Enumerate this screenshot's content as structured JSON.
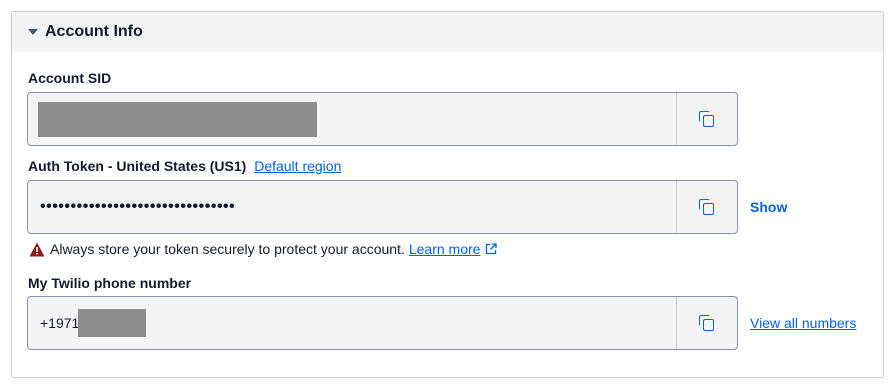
{
  "panel": {
    "title": "Account Info"
  },
  "account_sid": {
    "label": "Account SID",
    "value_redacted": true
  },
  "auth_token": {
    "label": "Auth Token - United States (US1)",
    "region_link": "Default region",
    "masked_value": "••••••••••••••••••••••••••••••••",
    "show_label": "Show"
  },
  "warning": {
    "text": "Always store your token securely to protect your account.",
    "link": "Learn more",
    "icon": "warning-triangle-icon",
    "icon_color": "#d61f1f"
  },
  "phone": {
    "label": "My Twilio phone number",
    "value_prefix": "+1971",
    "view_all_label": "View all numbers"
  },
  "colors": {
    "accent": "#0263e0",
    "field_bg": "#f4f4f6",
    "header_bg": "#f4f4f6",
    "redaction": "#8c8c8c"
  }
}
